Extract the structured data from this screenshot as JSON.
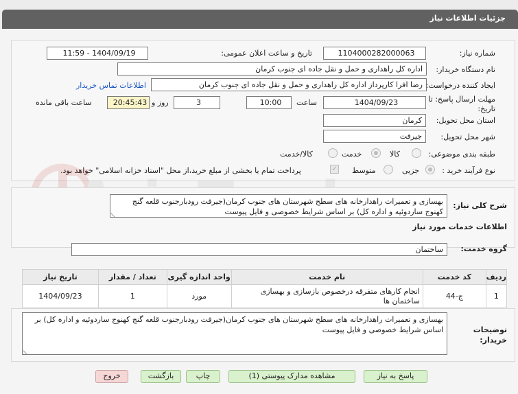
{
  "header": {
    "title": "جزئیات اطلاعات نیاز"
  },
  "labels": {
    "need_number": "شماره نیاز:",
    "announce_datetime": "تاریخ و ساعت اعلان عمومی:",
    "buyer_org": "نام دستگاه خریدار:",
    "creator": "ایجاد کننده درخواست:",
    "contact_link": "اطلاعات تماس خریدار",
    "deadline": "مهلت ارسال پاسخ: تا تاریخ:",
    "hour": "ساعت",
    "day_and": "روز و",
    "remaining": "ساعت باقی مانده",
    "province": "استان محل تحویل:",
    "city": "شهر محل تحویل:",
    "category": "طبقه بندی موضوعی:",
    "process_type": "نوع فرآیند خرید :",
    "payment_note": "پرداخت تمام یا بخشی از مبلغ خرید،از محل \"اسناد خزانه اسلامی\" خواهد بود.",
    "general_desc": "شرح کلی نیاز:",
    "services_info": "اطلاعات خدمات مورد نیاز",
    "service_group": "گروه خدمت:",
    "buyer_notes": "توضیحات خریدار:"
  },
  "fields": {
    "need_number": "1104000282000063",
    "announce_datetime": "1404/09/19 - 11:59",
    "buyer_org": "اداره کل راهداری و حمل و نقل جاده ای جنوب کرمان",
    "creator": "رضا افرا کارپرداز اداره کل راهداری و حمل و نقل جاده ای جنوب کرمان",
    "deadline_date": "1404/09/23",
    "deadline_time": "10:00",
    "days_left": "3",
    "time_left": "20:45:43",
    "province": "کرمان",
    "city": "جیرفت",
    "general_desc": "بهسازی و تعمیرات راهدارخانه های سطح شهرستان های جنوب کرمان(جیرفت رودبارجنوب قلعه گنج کهنوج ساردوئیه و اداره کل) بر اساس شرایط خصوصی و فایل پیوست",
    "service_group": "ساختمان",
    "buyer_notes": "بهسازی و تعمیرات راهدارخانه های سطح شهرستان های جنوب کرمان(جیرفت رودبارجنوب قلعه گنج کهنوج ساردوئیه و اداره کل) بر اساس شرایط خصوصی و فایل پیوست"
  },
  "category_options": [
    "کالا",
    "خدمت",
    "کالا/خدمت"
  ],
  "category_selected": "خدمت",
  "process_options": [
    "جزیی",
    "متوسط"
  ],
  "process_selected": "جزیی",
  "table": {
    "headers": [
      "ردیف",
      "کد خدمت",
      "نام خدمت",
      "واحد اندازه گیری",
      "تعداد / مقدار",
      "تاریخ نیاز"
    ],
    "rows": [
      [
        "1",
        "ج-44",
        "انجام کارهای متفرقه درخصوص بازسازی و بهسازی ساختمان ها",
        "مورد",
        "1",
        "1404/09/23"
      ]
    ]
  },
  "buttons": {
    "reply": "پاسخ به نیاز",
    "attachments": "مشاهده مدارک پیوستی (1)",
    "print": "چاپ",
    "back": "بازگشت",
    "exit": "خروج"
  },
  "watermark": {
    "text": "AriaTender.net"
  },
  "colors": {
    "header_bg": "#616161",
    "remaining_bg": "#fbf5c7",
    "link": "#1a56c4",
    "exit_bg": "#f7d6d6",
    "button_bg": "#d9f1cc"
  }
}
